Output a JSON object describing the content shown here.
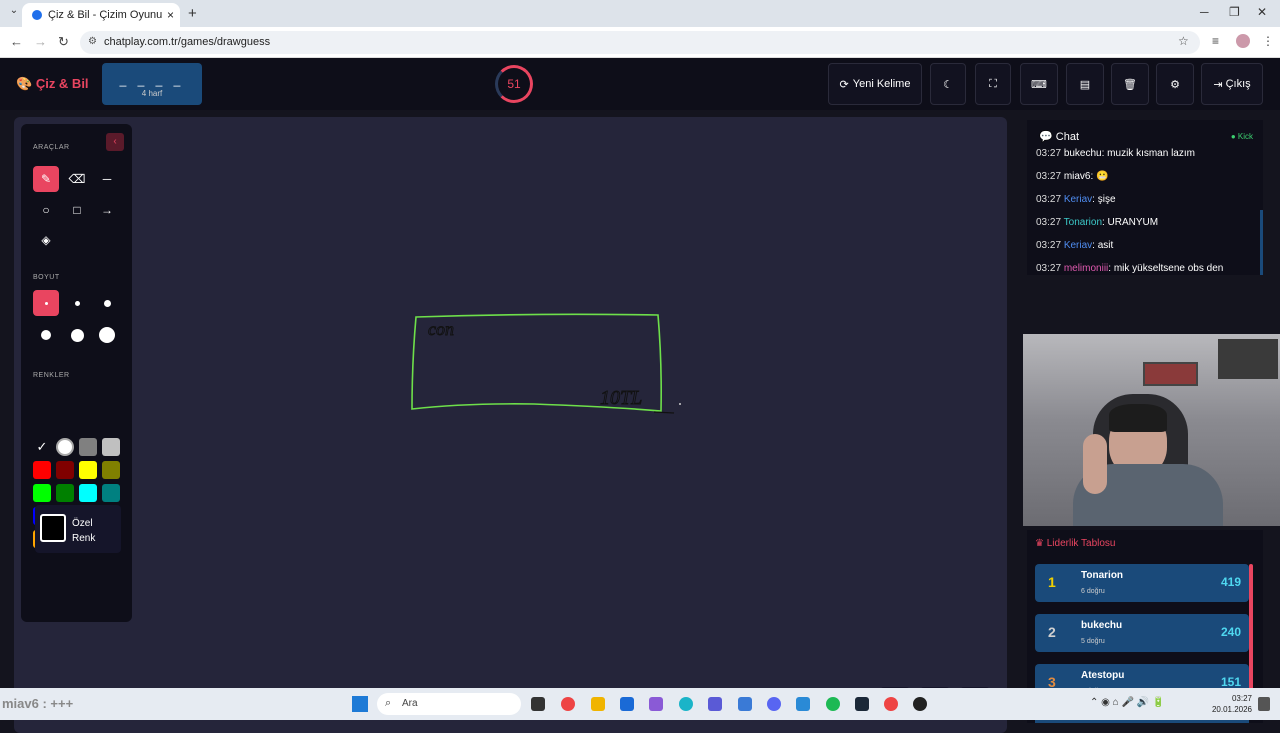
{
  "browser": {
    "tab_title": "Çiz & Bil - Çizim Oyunu",
    "tab_close": "×",
    "new_tab": "+",
    "url": "chatplay.com.tr/games/drawguess"
  },
  "header": {
    "logo": "Çiz & Bil",
    "word_mask": "_ _ _ _",
    "word_hint": "4 harf",
    "timer": "51",
    "new_word_label": "Yeni Kelime",
    "exit_label": "Çıkış"
  },
  "tools": {
    "section_tools": "ARAÇLAR",
    "section_size": "BOYUT",
    "section_colors": "RENKLER",
    "custom_color": "Özel Renk",
    "colors": [
      "#000000",
      "#ffffff",
      "#808080",
      "#c0c0c0",
      "#ff0000",
      "#800000",
      "#ffff00",
      "#808000",
      "#00ff00",
      "#008000",
      "#00ffff",
      "#008080",
      "#0000ff",
      "#000080",
      "#ff00ff",
      "#800080",
      "#ffa500",
      "#a52a2a",
      "#ffc0cb",
      "#ffd700"
    ]
  },
  "canvas": {
    "text_top": "con",
    "text_bottom": "10TL"
  },
  "chat": {
    "title": "Chat",
    "badge": "Kick",
    "messages": [
      {
        "time": "03:27",
        "user": "bukechu",
        "color": "#ffffff",
        "text": ": muzik kısman lazım"
      },
      {
        "time": "03:27",
        "user": "miav6",
        "color": "#ffffff",
        "text": ": 😬"
      },
      {
        "time": "03:27",
        "user": "Keriav",
        "color": "#4f8cf0",
        "text": ": şişe"
      },
      {
        "time": "03:27",
        "user": "Tonarion",
        "color": "#3cc8c8",
        "text": ": URANYUM"
      },
      {
        "time": "03:27",
        "user": "Keriav",
        "color": "#4f8cf0",
        "text": ": asit"
      },
      {
        "time": "03:27",
        "user": "melimoniii",
        "color": "#e05ab0",
        "text": ": mik yükseltsene obs den"
      }
    ]
  },
  "leaderboard": {
    "title": "Liderlik Tablosu",
    "rows": [
      {
        "rank": "1",
        "rank_color": "#f0d000",
        "name": "Tonarion",
        "correct": "6 doğru",
        "score": "419"
      },
      {
        "rank": "2",
        "rank_color": "#d0d0d0",
        "name": "bukechu",
        "correct": "5 doğru",
        "score": "240"
      },
      {
        "rank": "3",
        "rank_color": "#e08a40",
        "name": "Atestopu",
        "correct": "2 doğru",
        "score": "151"
      }
    ]
  },
  "taskbar": {
    "overlay_text": "miav6 : +++",
    "search": "Ara",
    "time": "03:27",
    "date": "20.01.2026"
  }
}
